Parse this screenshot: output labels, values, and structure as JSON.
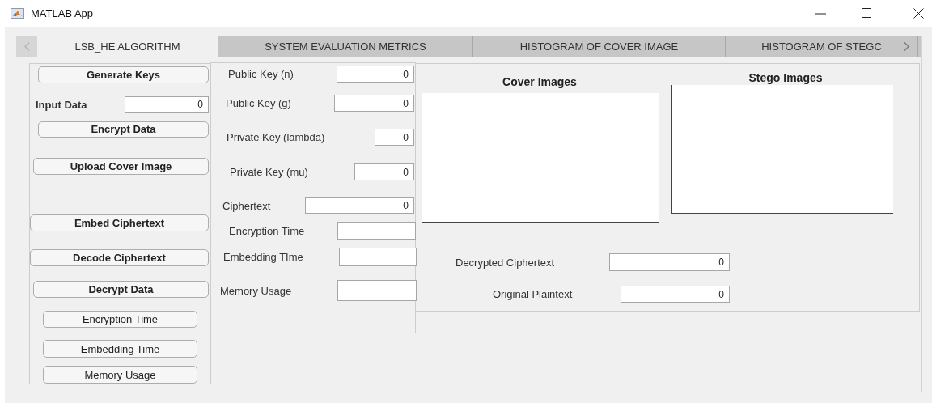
{
  "window": {
    "title": "MATLAB App"
  },
  "tabs": [
    {
      "label": "LSB_HE ALGORITHM",
      "selected": true
    },
    {
      "label": "SYSTEM EVALUATION METRICS",
      "selected": false
    },
    {
      "label": "HISTOGRAM OF COVER IMAGE",
      "selected": false
    },
    {
      "label": "HISTOGRAM OF STEGC",
      "selected": false
    }
  ],
  "left_panel": {
    "items": [
      {
        "kind": "strong",
        "label": "Generate Keys"
      },
      {
        "kind": "field",
        "label": "Input Data",
        "value": "0"
      },
      {
        "kind": "strong",
        "label": "Encrypt Data"
      },
      {
        "kind": "strong",
        "label": "Upload Cover Image"
      },
      {
        "kind": "strong",
        "label": "Embed Ciphertext"
      },
      {
        "kind": "strong",
        "label": "Decode Ciphertext"
      },
      {
        "kind": "strong",
        "label": "Decrypt Data"
      },
      {
        "kind": "plain",
        "label": "Encryption Time"
      },
      {
        "kind": "plain",
        "label": "Embedding Time"
      },
      {
        "kind": "plain",
        "label": "Memory Usage"
      }
    ]
  },
  "middle_panel": {
    "fields": [
      {
        "label": "Public Key (n)",
        "value": "0"
      },
      {
        "label": "Public Key (g)",
        "value": "0"
      },
      {
        "label": "Private Key (lambda)",
        "value": "0"
      },
      {
        "label": "Private Key (mu)",
        "value": "0"
      },
      {
        "label": "Ciphertext",
        "value": "0"
      },
      {
        "label": "Encryption Time"
      },
      {
        "label": "Embedding TIme"
      },
      {
        "label": "Memory Usage"
      }
    ]
  },
  "right_panel": {
    "axes": [
      {
        "title": "Cover Images"
      },
      {
        "title": "Stego Images"
      }
    ],
    "fields": [
      {
        "label": "Decrypted Ciphertext",
        "value": "0"
      },
      {
        "label": "Original Plaintext",
        "value": "0"
      }
    ]
  }
}
